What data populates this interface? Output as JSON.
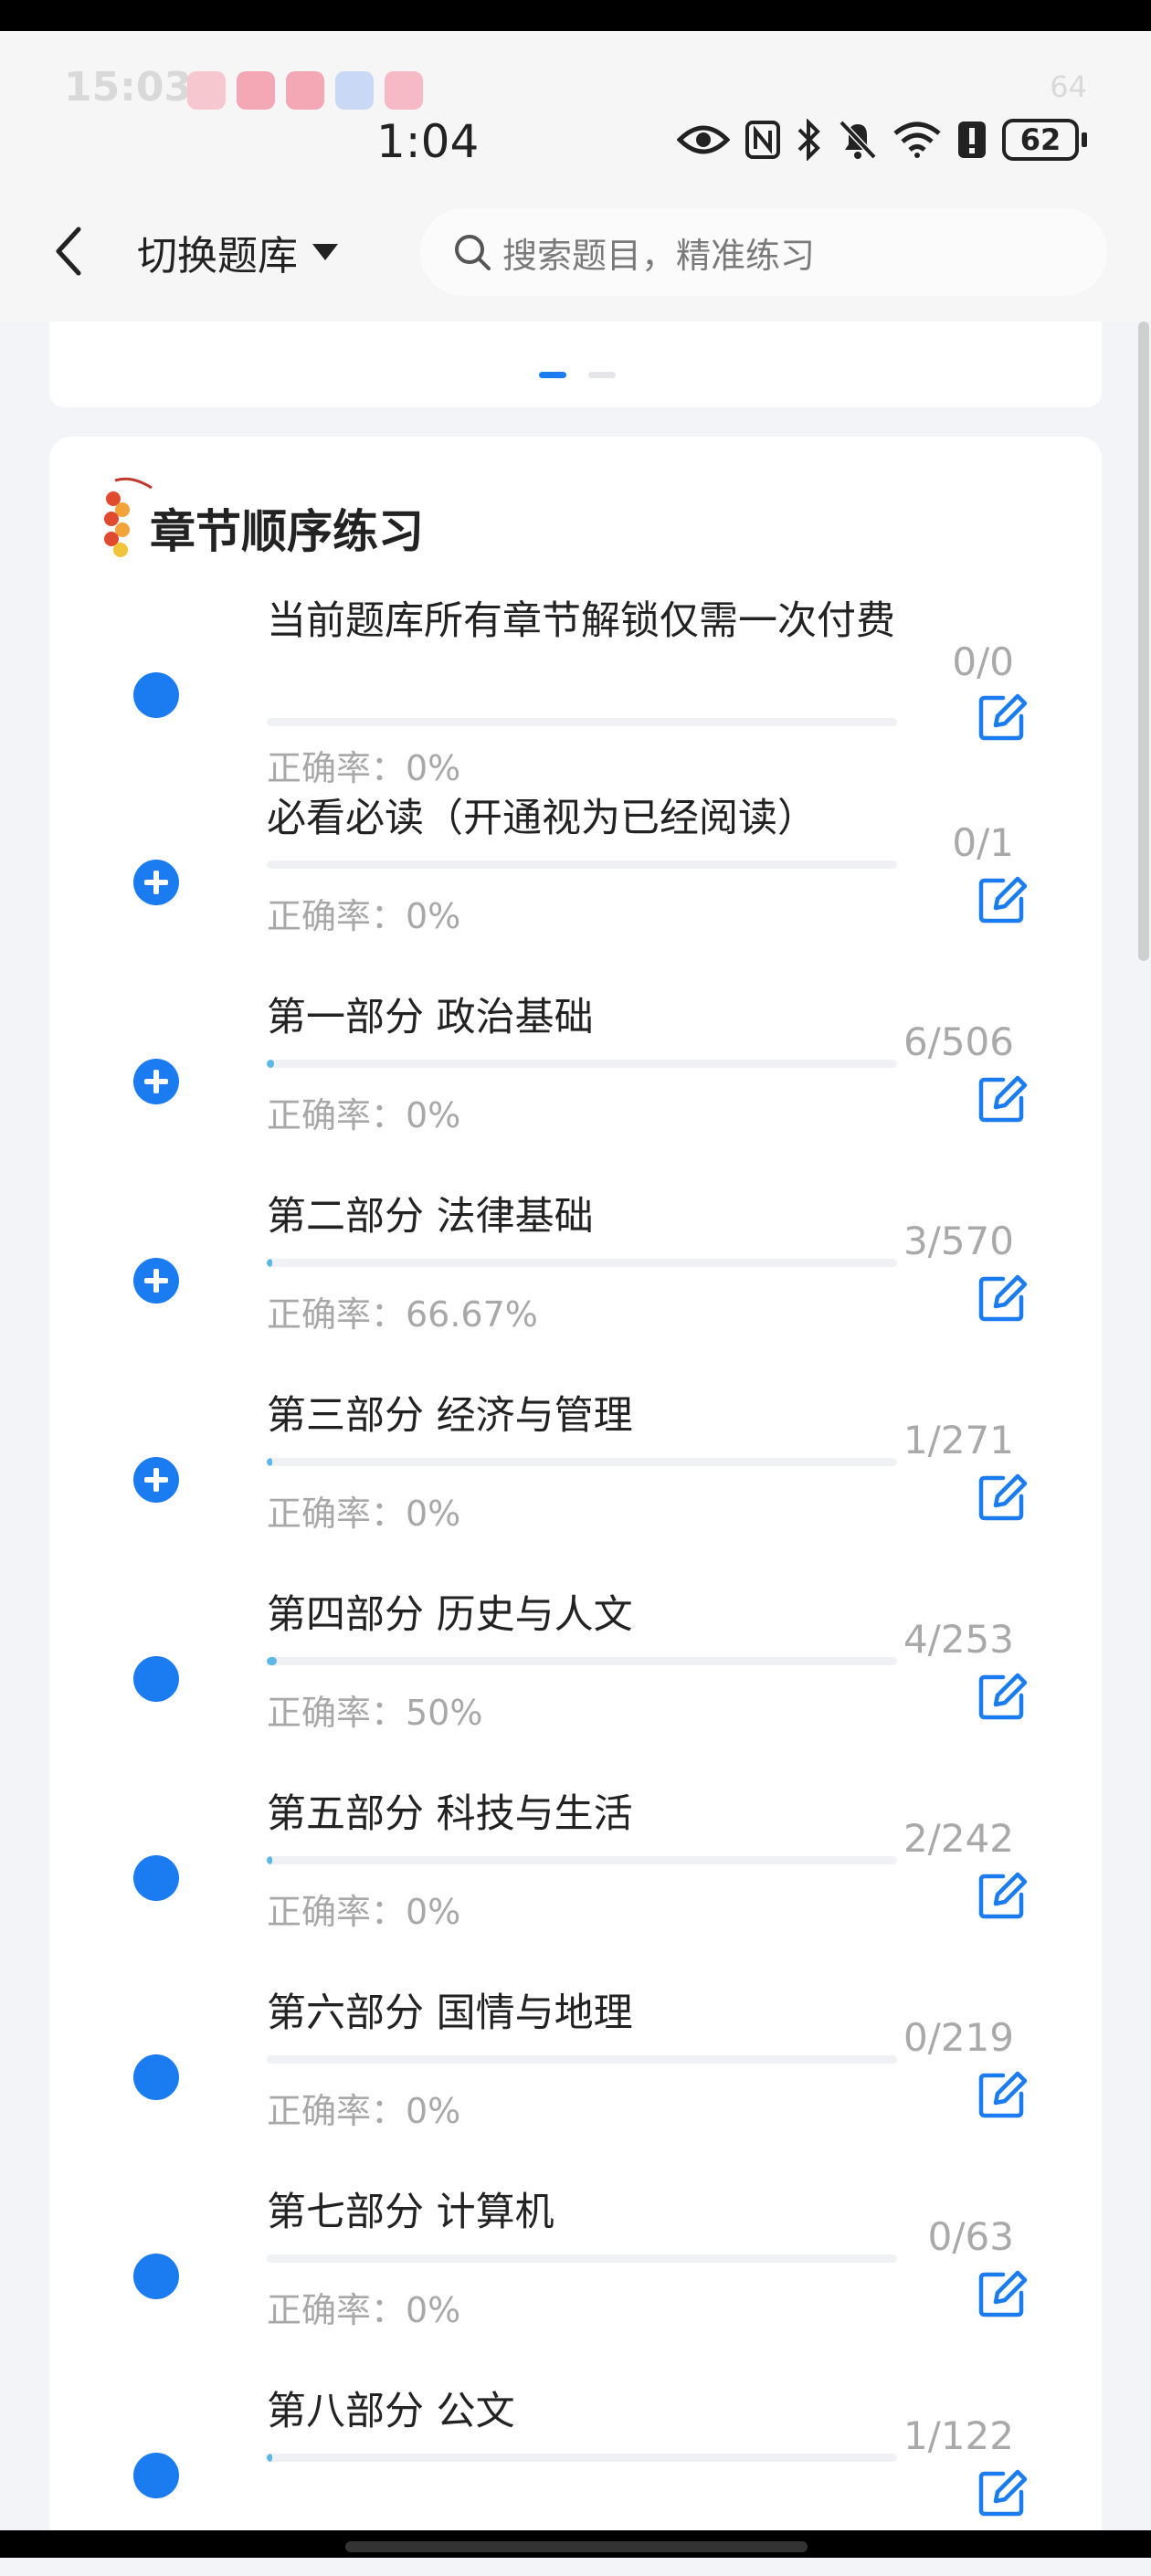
{
  "status_bar": {
    "ghost_time": "15:03",
    "ghost_battery": "64",
    "time": "1:04",
    "battery": "62"
  },
  "nav": {
    "switch_label": "切换题库",
    "search_placeholder": "搜索题目，精准练习"
  },
  "section": {
    "title": "章节顺序练习"
  },
  "chapters": [
    {
      "title": "当前题库所有章节解锁仅需一次付费",
      "count": "0/0",
      "rate": "正确率：0%",
      "progress": 0,
      "marker": "dot"
    },
    {
      "title": "必看必读（开通视为已经阅读）",
      "count": "0/1",
      "rate": "正确率：0%",
      "progress": 0,
      "marker": "plus"
    },
    {
      "title": "第一部分 政治基础",
      "count": "6/506",
      "rate": "正确率：0%",
      "progress": 0.012,
      "marker": "plus"
    },
    {
      "title": "第二部分 法律基础",
      "count": "3/570",
      "rate": "正确率：66.67%",
      "progress": 0.005,
      "marker": "plus"
    },
    {
      "title": "第三部分 经济与管理",
      "count": "1/271",
      "rate": "正确率：0%",
      "progress": 0.004,
      "marker": "plus"
    },
    {
      "title": "第四部分 历史与人文",
      "count": "4/253",
      "rate": "正确率：50%",
      "progress": 0.016,
      "marker": "dot"
    },
    {
      "title": "第五部分 科技与生活",
      "count": "2/242",
      "rate": "正确率：0%",
      "progress": 0.008,
      "marker": "dot"
    },
    {
      "title": "第六部分 国情与地理",
      "count": "0/219",
      "rate": "正确率：0%",
      "progress": 0,
      "marker": "dot"
    },
    {
      "title": "第七部分 计算机",
      "count": "0/63",
      "rate": "正确率：0%",
      "progress": 0,
      "marker": "dot"
    },
    {
      "title": "第八部分 公文",
      "count": "1/122",
      "rate": "",
      "progress": 0.008,
      "marker": "dot"
    }
  ],
  "colors": {
    "accent": "#1a7cf0",
    "progress": "#5cb8e6",
    "muted_text": "#a9a9a9"
  },
  "icons": {
    "back": "chevron-left-icon",
    "dropdown": "caret-down-icon",
    "search": "search-icon",
    "edit": "edit-icon",
    "section": "firecracker-icon"
  }
}
